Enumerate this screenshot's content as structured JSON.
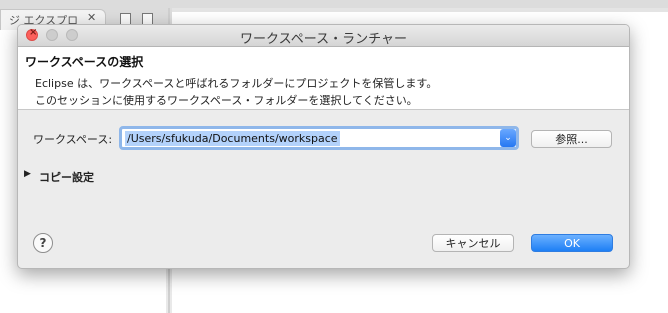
{
  "background": {
    "tab_label": "ジ エクスプロ",
    "tab_close": "✕"
  },
  "dialog": {
    "window_title": "ワークスペース・ランチャー",
    "header_title": "ワークスペースの選択",
    "header_line1": "Eclipse は、ワークスペースと呼ばれるフォルダーにプロジェクトを保管します。",
    "header_line2": "このセッションに使用するワークスペース・フォルダーを選択してください。",
    "workspace_label": "ワークスペース:",
    "workspace_value": "/Users/sfukuda/Documents/workspace",
    "browse_label": "参照...",
    "copy_settings_label": "コピー設定",
    "cancel_label": "キャンセル",
    "ok_label": "OK",
    "help_glyph": "?",
    "close_glyph": "×",
    "dropdown_glyph": "⌄",
    "toggle_glyph": "▶"
  },
  "colors": {
    "accent": "#1e7ff5",
    "close_red": "#fc605c",
    "selection": "#b3d2fb"
  }
}
